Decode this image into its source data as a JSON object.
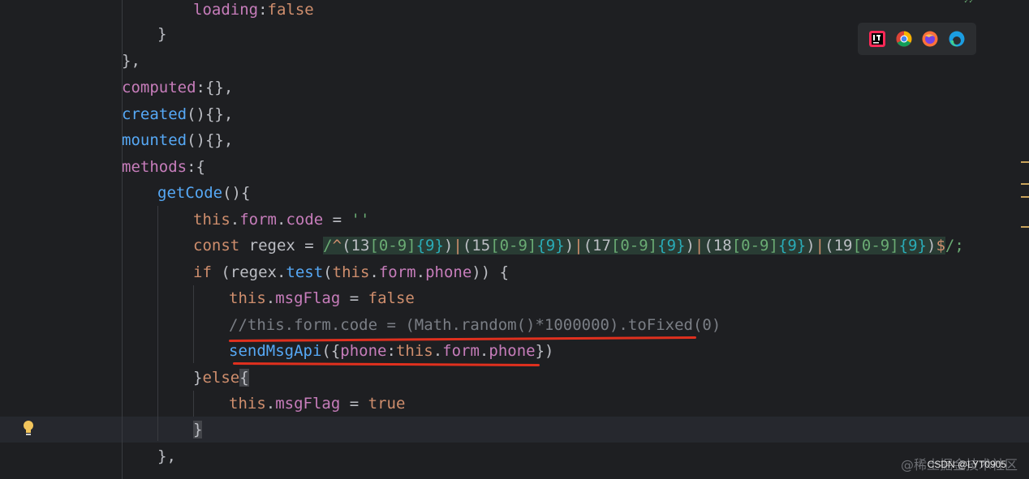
{
  "code": {
    "l1": {
      "prop": "loading",
      "sep": ":",
      "val": "false"
    },
    "l2": {
      "text": "}"
    },
    "l3": {
      "text": "},"
    },
    "l4": {
      "prop": "computed",
      "rest": ":{},"
    },
    "l5": {
      "fn": "created",
      "rest": "(){},"
    },
    "l6": {
      "fn": "mounted",
      "rest": "(){},"
    },
    "l7": {
      "prop": "methods",
      "rest": ":{"
    },
    "l8": {
      "fn": "getCode",
      "rest": "(){"
    },
    "l9": {
      "kw": "this",
      "dot": ".",
      "p1": "form",
      "dot2": ".",
      "p2": "code",
      "eq": " = ",
      "str": "''"
    },
    "l10": {
      "kw": "const",
      "name": " regex = ",
      "slash": "/",
      "caret": "^",
      "g1open": "(13",
      "b1": "[0-9]",
      "q1": "{9}",
      "g1close": ")",
      "pipe1": "|",
      "g2open": "(15",
      "b2": "[0-9]",
      "q2": "{9}",
      "g2close": ")",
      "pipe2": "|",
      "g3open": "(17",
      "b3": "[0-9]",
      "q3": "{9}",
      "g3close": ")",
      "pipe3": "|",
      "g4open": "(18",
      "b4": "[0-9]",
      "q4": "{9}",
      "g4close": ")",
      "pipe4": "|",
      "g5open": "(19",
      "b5": "[0-9]",
      "q5": "{9}",
      "g5close": ")",
      "dollar": "$",
      "end": "/;"
    },
    "l11": {
      "kw": "if",
      "open": " (regex.",
      "fn": "test",
      "paren": "(",
      "this": "this",
      "dot": ".",
      "p1": "form",
      "dot2": ".",
      "p2": "phone",
      "close": ")) {"
    },
    "l12": {
      "kw": "this",
      "dot": ".",
      "prop": "msgFlag",
      "eq": " = ",
      "val": "false"
    },
    "l13": {
      "comment": "//this.form.code = (Math.random()*1000000).toFixed(0)"
    },
    "l14": {
      "fn": "sendMsgApi",
      "open": "({",
      "prop": "phone",
      "colon": ":",
      "this": "this",
      "dot": ".",
      "p1": "form",
      "dot2": ".",
      "p2": "phone",
      "close": "})"
    },
    "l15": {
      "text": "}",
      "kw": "else",
      "brace": "{"
    },
    "l16": {
      "kw": "this",
      "dot": ".",
      "prop": "msgFlag",
      "eq": " = ",
      "val": "true"
    },
    "l17": {
      "text": "}"
    },
    "l18": {
      "text": "},"
    }
  },
  "browser_icons": [
    "intellij-icon",
    "chrome-icon",
    "firefox-icon",
    "edge-icon"
  ],
  "watermark": {
    "cn": "@稀土掘金技术社区",
    "en": "CSDN @LYT0905"
  },
  "colors": {
    "background": "#1e1f22",
    "keyword": "#cf8e6d",
    "property": "#c77dbb",
    "function": "#56a8f5",
    "string": "#6aab73",
    "comment": "#7a7e85",
    "number": "#2aacb8",
    "underline": "#e0301e"
  }
}
